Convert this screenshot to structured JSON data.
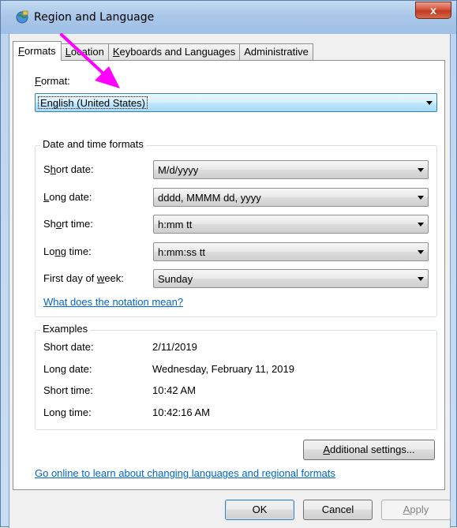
{
  "window": {
    "title": "Region and Language",
    "close_glyph": "x"
  },
  "tabs": [
    {
      "label": "Formats",
      "accesskey": "F",
      "rest": "ormats",
      "active": true
    },
    {
      "label": "Location",
      "accesskey": "L",
      "rest": "ocation",
      "active": false
    },
    {
      "label": "Keyboards and Languages",
      "accesskey": "K",
      "rest": "eyboards and Languages",
      "active": false
    },
    {
      "label": "Administrative",
      "accesskey": "",
      "rest": "Administrative",
      "active": false
    }
  ],
  "format": {
    "label_ak": "F",
    "label_rest": "ormat:",
    "value": "English (United States)"
  },
  "date_time_formats": {
    "group_title": "Date and time formats",
    "rows": [
      {
        "label_pre": "S",
        "label_ak": "h",
        "label_post": "ort date:",
        "value": "M/d/yyyy"
      },
      {
        "label_pre": "",
        "label_ak": "L",
        "label_post": "ong date:",
        "value": "dddd, MMMM dd, yyyy"
      },
      {
        "label_pre": "Sh",
        "label_ak": "o",
        "label_post": "rt time:",
        "value": "h:mm tt"
      },
      {
        "label_pre": "Lo",
        "label_ak": "n",
        "label_post": "g time:",
        "value": "h:mm:ss tt"
      },
      {
        "label_pre": "First day of ",
        "label_ak": "w",
        "label_post": "eek:",
        "value": "Sunday"
      }
    ],
    "notation_link": "What does the notation mean?"
  },
  "examples": {
    "group_title": "Examples",
    "rows": [
      {
        "label": "Short date:",
        "value": "2/11/2019"
      },
      {
        "label": "Long date:",
        "value": "Wednesday, February 11, 2019"
      },
      {
        "label": "Short time:",
        "value": "10:42 AM"
      },
      {
        "label": "Long time:",
        "value": "10:42:16 AM"
      }
    ]
  },
  "additional_settings": {
    "ak": "A",
    "rest": "dditional settings..."
  },
  "online_link": "Go online to learn about changing languages and regional formats",
  "buttons": {
    "ok": "OK",
    "cancel": "Cancel",
    "apply_ak": "A",
    "apply_rest": "pply"
  },
  "colors": {
    "link": "#0066cc",
    "annotation_arrow": "#ff00ff"
  }
}
